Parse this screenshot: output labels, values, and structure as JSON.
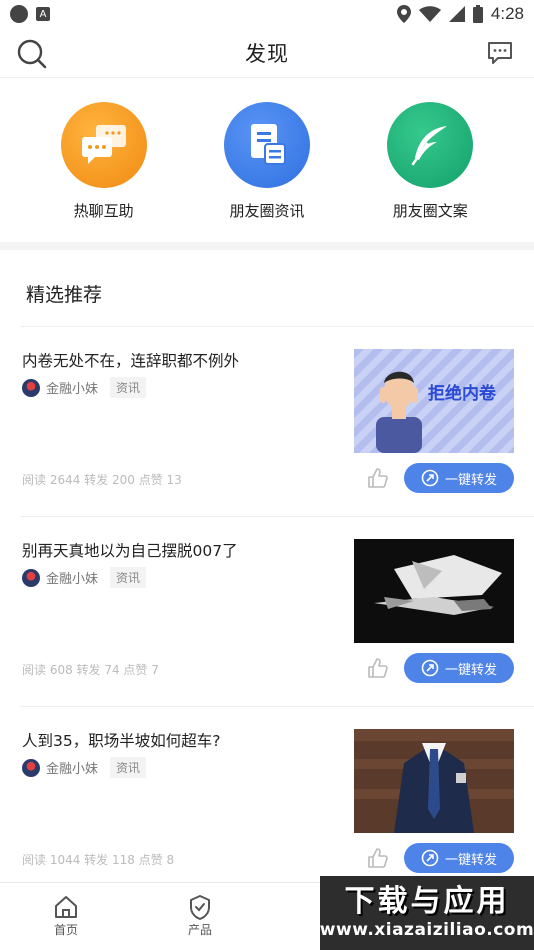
{
  "status_bar": {
    "time": "4:28"
  },
  "header": {
    "title": "发现"
  },
  "quick_entries": [
    {
      "label": "热聊互助",
      "color": "#f39a1d",
      "icon": "chat-bubbles-icon"
    },
    {
      "label": "朋友圈资讯",
      "color": "#3a78e6",
      "icon": "document-icon"
    },
    {
      "label": "朋友圈文案",
      "color": "#1fb07a",
      "icon": "feather-icon"
    }
  ],
  "section": {
    "title": "精选推荐"
  },
  "articles": [
    {
      "title": "内卷无处不在，连辞职都不例外",
      "author": "金融小妹",
      "tag": "资讯",
      "stats": "阅读 2644  转发 200  点赞 13",
      "share_label": "一键转发",
      "thumb_text": "拒绝内卷"
    },
    {
      "title": "别再天真地以为自己摆脱007了",
      "author": "金融小妹",
      "tag": "资讯",
      "stats": "阅读 608  转发 74  点赞 7",
      "share_label": "一键转发"
    },
    {
      "title": "人到35，职场半坡如何超车?",
      "author": "金融小妹",
      "tag": "资讯",
      "stats": "阅读 1044  转发 118  点赞 8",
      "share_label": "一键转发"
    }
  ],
  "bottom_nav": [
    {
      "label": "首页",
      "icon": "home-icon"
    },
    {
      "label": "产品",
      "icon": "shield-check-icon"
    }
  ],
  "watermark": {
    "line1": "下载与应用",
    "line2": "www.xiazaiziliao.com"
  },
  "colors": {
    "accent": "#4e83e8",
    "orange": "#f39a1d",
    "blue": "#3a78e6",
    "green": "#1fb07a"
  }
}
